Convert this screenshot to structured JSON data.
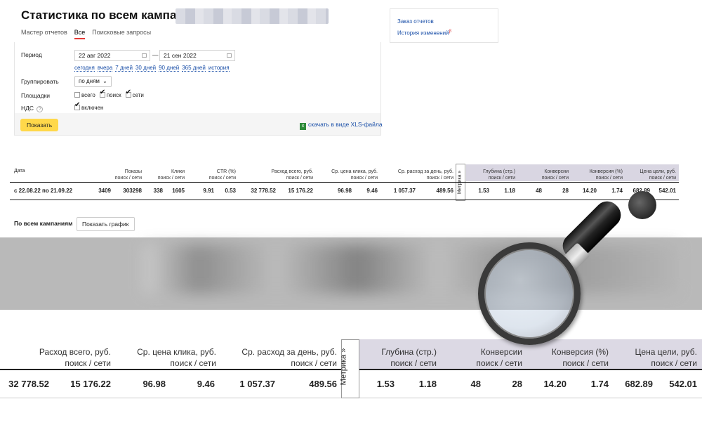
{
  "header": {
    "title": "Статистика по всем кампаниям:",
    "tabs": [
      "Мастер отчетов",
      "Все",
      "Поисковые запросы"
    ],
    "active_tab": "Все"
  },
  "side_links": {
    "order_reports": "Заказ отчетов",
    "change_history": "История изменений",
    "change_history_sup": "β"
  },
  "form": {
    "period_label": "Период",
    "date_from": "22 авг 2022",
    "date_to": "21 сен 2022",
    "dash": "—",
    "quick_links": [
      "сегодня",
      "вчера",
      "7 дней",
      "30 дней",
      "90 дней",
      "365 дней",
      "история"
    ],
    "group_label": "Группировать",
    "group_value": "по дням",
    "platforms_label": "Площадки",
    "platforms": [
      {
        "label": "всего",
        "checked": false
      },
      {
        "label": "поиск",
        "checked": true
      },
      {
        "label": "сети",
        "checked": true
      }
    ],
    "vat_label": "НДС",
    "vat_help": "?",
    "vat_checkbox": "включен",
    "show_button": "Показать",
    "xls_link": "скачать в виде XLS-файла"
  },
  "small_table": {
    "headers": {
      "date": "Дата",
      "shows": "Показы",
      "shows_sub": "поиск / сети",
      "clicks": "Клики",
      "clicks_sub": "поиск / сети",
      "ctr": "CTR (%)",
      "ctr_sub": "поиск / сети",
      "spend": "Расход всего, руб.",
      "spend_sub": "поиск / сети",
      "cpc": "Ср. цена клика, руб.",
      "cpc_sub": "поиск / сети",
      "daily": "Ср. расход за день, руб.",
      "daily_sub": "поиск / сети",
      "depth": "Глубина (стр.)",
      "depth_sub": "поиск / сети",
      "conv": "Конверсии",
      "conv_sub": "поиск / сети",
      "conv_pct": "Конверсия (%)",
      "conv_pct_sub": "поиск / сети",
      "goal_price": "Цена цели, руб.",
      "goal_price_sub": "поиск / сети"
    },
    "metrika": "Метрика »",
    "row": {
      "date": "с 22.08.22 по 21.09.22",
      "shows_search": "3409",
      "shows_net": "303298",
      "clicks_search": "338",
      "clicks_net": "1605",
      "ctr_search": "9.91",
      "ctr_net": "0.53",
      "spend_search": "32 778.52",
      "spend_net": "15 176.22",
      "cpc_search": "96.98",
      "cpc_net": "9.46",
      "daily_search": "1 057.37",
      "daily_net": "489.56",
      "depth_search": "1.53",
      "depth_net": "1.18",
      "conv_search": "48",
      "conv_net": "28",
      "conv_pct_search": "14.20",
      "conv_pct_net": "1.74",
      "goal_search": "682.89",
      "goal_net": "542.01"
    }
  },
  "campaigns": {
    "label": "По всем кампаниям",
    "graph_button": "Показать график"
  },
  "zoomed_table": {
    "headers": {
      "spend": "Расход всего, руб.",
      "cpc": "Ср. цена клика, руб.",
      "daily": "Ср. расход за день, руб.",
      "depth": "Глубина (стр.)",
      "conv": "Конверсии",
      "conv_pct": "Конверсия (%)",
      "goal_price": "Цена цели, руб.",
      "sub": "поиск / сети"
    },
    "metrika": "Метрика »",
    "row": {
      "spend_search": "32 778.52",
      "spend_net": "15 176.22",
      "cpc_search": "96.98",
      "cpc_net": "9.46",
      "daily_search": "1 057.37",
      "daily_net": "489.56",
      "depth_search": "1.53",
      "depth_net": "1.18",
      "conv_search": "48",
      "conv_net": "28",
      "conv_pct_search": "14.20",
      "conv_pct_net": "1.74",
      "goal_search": "682.89",
      "goal_net": "542.01"
    }
  },
  "icons": {
    "magnifier": "magnifier-icon",
    "calendar": "calendar-icon",
    "xls": "xls-file-icon"
  },
  "colors": {
    "accent_yellow": "#ffd84a",
    "link_blue": "#1a4fa8",
    "tab_underline": "#e53935",
    "metrika_header_bg": "#d9d6e2"
  }
}
